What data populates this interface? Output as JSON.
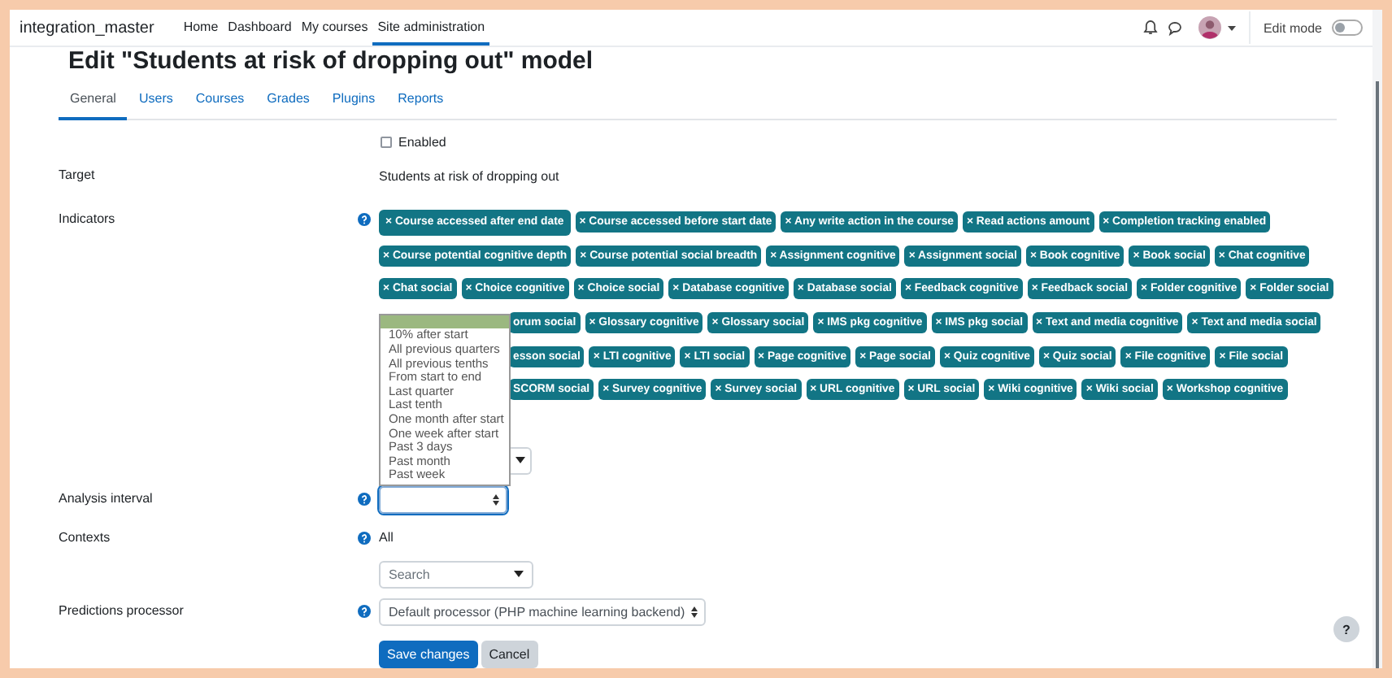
{
  "navbar": {
    "brand": "integration_master",
    "links": [
      {
        "label": "Home",
        "selected": false
      },
      {
        "label": "Dashboard",
        "selected": false
      },
      {
        "label": "My courses",
        "selected": false
      },
      {
        "label": "Site administration",
        "selected": true
      }
    ],
    "edit_mode": {
      "label": "Edit mode",
      "on": false
    }
  },
  "page_title": "Edit \"Students at risk of dropping out\" model",
  "tabs": [
    {
      "label": "General",
      "selected": true
    },
    {
      "label": "Users",
      "selected": false
    },
    {
      "label": "Courses",
      "selected": false
    },
    {
      "label": "Grades",
      "selected": false
    },
    {
      "label": "Plugins",
      "selected": false
    },
    {
      "label": "Reports",
      "selected": false
    }
  ],
  "enabled": {
    "label": "Enabled",
    "checked": false
  },
  "target": {
    "label": "Target",
    "value": "Students at risk of dropping out"
  },
  "indicators": {
    "label": "Indicators",
    "rows": [
      {
        "covered": false,
        "chips": [
          {
            "label": "× Course accessed after end date",
            "selected": true
          },
          {
            "label": "× Course accessed before start date",
            "selected": false
          },
          {
            "label": "× Any write action in the course",
            "selected": false
          },
          {
            "label": "× Read actions amount",
            "selected": false
          },
          {
            "label": "× Completion tracking enabled",
            "selected": false
          }
        ]
      },
      {
        "covered": false,
        "chips": [
          {
            "label": "× Course potential cognitive depth",
            "selected": false
          },
          {
            "label": "× Course potential social breadth",
            "selected": false
          },
          {
            "label": "× Assignment cognitive",
            "selected": false
          },
          {
            "label": "× Assignment social",
            "selected": false
          },
          {
            "label": "× Book cognitive",
            "selected": false
          },
          {
            "label": "× Book social",
            "selected": false
          },
          {
            "label": "× Chat cognitive",
            "selected": false
          }
        ]
      },
      {
        "covered": false,
        "chips": [
          {
            "label": "× Chat social",
            "selected": false
          },
          {
            "label": "× Choice cognitive",
            "selected": false
          },
          {
            "label": "× Choice social",
            "selected": false
          },
          {
            "label": "× Database cognitive",
            "selected": false
          },
          {
            "label": "× Database social",
            "selected": false
          },
          {
            "label": "× Feedback cognitive",
            "selected": false
          },
          {
            "label": "× Feedback social",
            "selected": false
          },
          {
            "label": "× Folder cognitive",
            "selected": false
          },
          {
            "label": "× Folder social",
            "selected": false
          }
        ]
      },
      {
        "covered": true,
        "chips": [
          {
            "label": "orum social",
            "selected": false
          },
          {
            "label": "× Glossary cognitive",
            "selected": false
          },
          {
            "label": "× Glossary social",
            "selected": false
          },
          {
            "label": "× IMS pkg cognitive",
            "selected": false
          },
          {
            "label": "× IMS pkg social",
            "selected": false
          },
          {
            "label": "× Text and media cognitive",
            "selected": false
          },
          {
            "label": "× Text and media social",
            "selected": false
          }
        ]
      },
      {
        "covered": true,
        "chips": [
          {
            "label": "esson social",
            "selected": false
          },
          {
            "label": "× LTI cognitive",
            "selected": false
          },
          {
            "label": "× LTI social",
            "selected": false
          },
          {
            "label": "× Page cognitive",
            "selected": false
          },
          {
            "label": "× Page social",
            "selected": false
          },
          {
            "label": "× Quiz cognitive",
            "selected": false
          },
          {
            "label": "× Quiz social",
            "selected": false
          },
          {
            "label": "× File cognitive",
            "selected": false
          },
          {
            "label": "× File social",
            "selected": false
          }
        ]
      },
      {
        "covered": true,
        "chips": [
          {
            "label": "SCORM social",
            "selected": false
          },
          {
            "label": "× Survey cognitive",
            "selected": false
          },
          {
            "label": "× Survey social",
            "selected": false
          },
          {
            "label": "× URL cognitive",
            "selected": false
          },
          {
            "label": "× URL social",
            "selected": false
          },
          {
            "label": "× Wiki cognitive",
            "selected": false
          },
          {
            "label": "× Wiki social",
            "selected": false
          },
          {
            "label": "× Workshop cognitive",
            "selected": false
          }
        ]
      }
    ]
  },
  "analysis_interval": {
    "label": "Analysis interval",
    "open": true,
    "options": [
      "10% after start",
      "All previous quarters",
      "All previous tenths",
      "From start to end",
      "Last quarter",
      "Last tenth",
      "One month after start",
      "One week after start",
      "Past 3 days",
      "Past month",
      "Past week"
    ]
  },
  "contexts": {
    "label": "Contexts",
    "value": "All",
    "search": {
      "placeholder": "Search"
    }
  },
  "predictions_processor": {
    "label": "Predictions processor",
    "value": "Default processor (PHP machine learning backend)"
  },
  "buttons": [
    {
      "label": "Save changes",
      "kind": "primary"
    },
    {
      "label": "Cancel",
      "kind": "secondary"
    }
  ],
  "help_button": "?"
}
